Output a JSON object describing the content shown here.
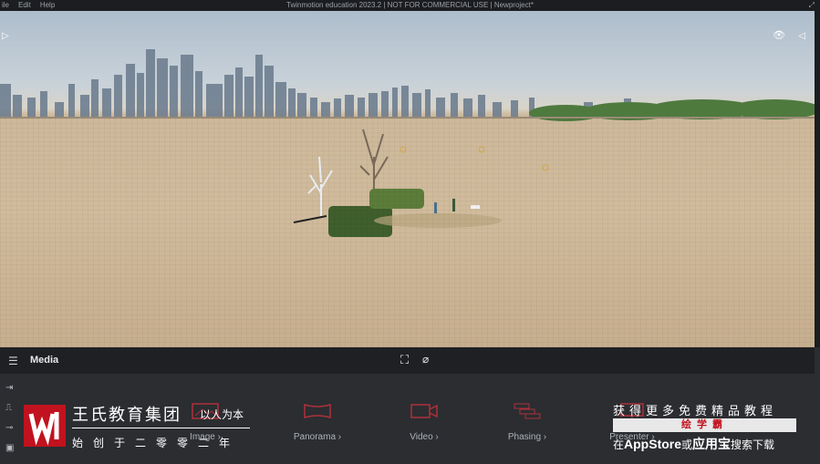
{
  "menu": [
    "ile",
    "Edit",
    "Help"
  ],
  "window_title": "Twinmotion education 2023.2 | NOT FOR COMMERCIAL USE | Newproject*",
  "bottombar": {
    "title": "Media"
  },
  "media_items": [
    {
      "label": "Image",
      "icon": "image-icon"
    },
    {
      "label": "Panorama",
      "icon": "panorama-icon"
    },
    {
      "label": "Video",
      "icon": "video-icon"
    },
    {
      "label": "Phasing",
      "icon": "phasing-icon"
    },
    {
      "label": "Presenter",
      "icon": "presenter-icon"
    }
  ],
  "watermark": {
    "org": "王氏教育集团",
    "slogan": "以人为本",
    "since": "始创于二零零二年",
    "right_line1": "获得更多免费精品教程",
    "right_line2": "绘学霸",
    "right_line3_pre": "在",
    "right_line3_bold": "AppStore",
    "right_line3_mid": "或",
    "right_line3_bold2": "应用宝",
    "right_line3_post": "搜索下载"
  },
  "colors": {
    "accent": "#c1121f",
    "panel": "#2b2d31",
    "icon": "#b0303a"
  }
}
